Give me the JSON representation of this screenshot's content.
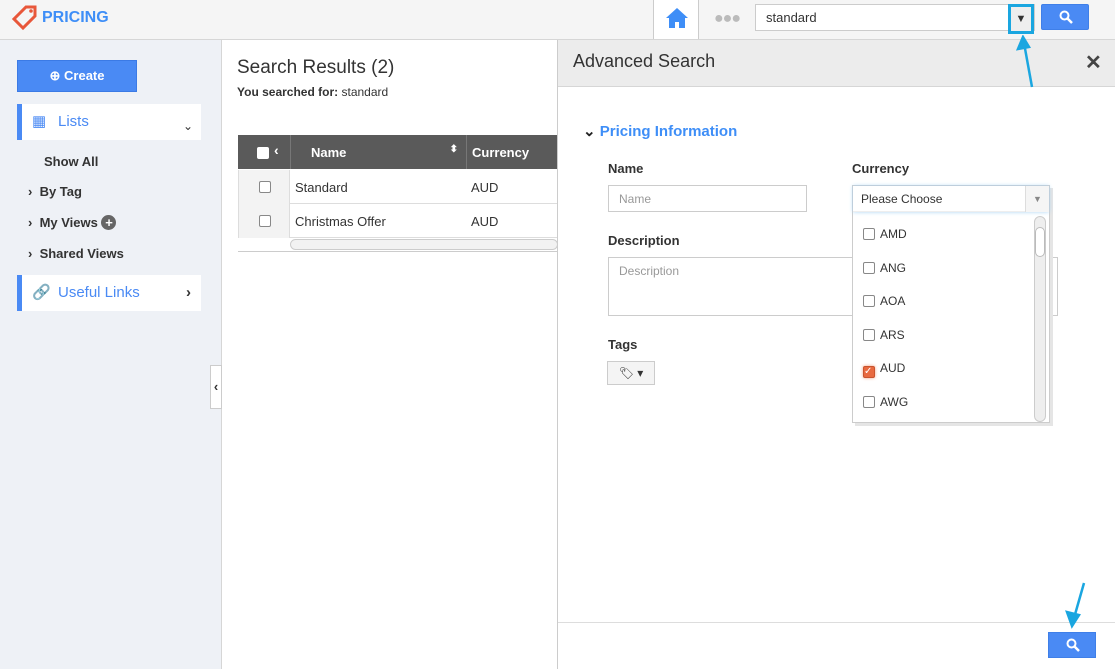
{
  "app": {
    "title": "PRICING",
    "accent": "#4a8af4"
  },
  "topbar": {
    "search_value": "standard",
    "home_icon": "home-icon",
    "more_icon": "dots-icon"
  },
  "sidebar": {
    "create_label": "Create",
    "lists_label": "Lists",
    "links": [
      {
        "label": "Show All"
      },
      {
        "label": "By Tag"
      },
      {
        "label": "My Views"
      },
      {
        "label": "Shared Views"
      }
    ],
    "useful_links_label": "Useful Links"
  },
  "main": {
    "title": "Search Results (2)",
    "searched_label": "You searched for:",
    "searched_value": "standard",
    "columns": [
      "Name",
      "Currency"
    ],
    "rows": [
      {
        "name": "Standard",
        "currency": "AUD"
      },
      {
        "name": "Christmas Offer",
        "currency": "AUD"
      }
    ]
  },
  "advanced": {
    "title": "Advanced Search",
    "section": "Pricing Information",
    "name_label": "Name",
    "name_placeholder": "Name",
    "currency_label": "Currency",
    "currency_value": "Please Choose",
    "description_label": "Description",
    "description_placeholder": "Description",
    "tags_label": "Tags",
    "options": [
      {
        "code": "AMD",
        "checked": false
      },
      {
        "code": "ANG",
        "checked": false
      },
      {
        "code": "AOA",
        "checked": false
      },
      {
        "code": "ARS",
        "checked": false
      },
      {
        "code": "AUD",
        "checked": true
      },
      {
        "code": "AWG",
        "checked": false
      }
    ]
  }
}
